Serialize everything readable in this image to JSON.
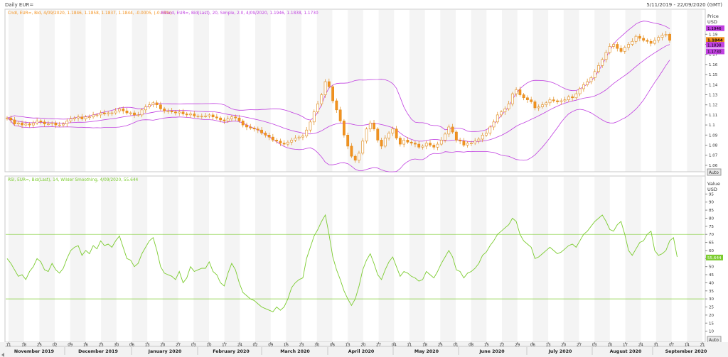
{
  "window": {
    "title": "Daily EUR=",
    "date_range": "5/11/2019 - 22/09/2020 (GMT)"
  },
  "price_panel": {
    "legend_ohlc": "Cndl, EUR=, Bid, 4/09/2020, 1.1846, 1.1858, 1.1837, 1.1844, -0.0005, (-0.04%)",
    "legend_bband": "BBand, EUR=, Bid(Last), 20, Simple, 2.0, 4/09/2020, 1.1946, 1.1838, 1.1730",
    "axis_title": "Price",
    "axis_unit": "USD",
    "auto_label": "Auto",
    "ticks": [
      "1.06",
      "1.07",
      "1.08",
      "1.09",
      "1.1",
      "1.11",
      "1.12",
      "1.13",
      "1.14",
      "1.15",
      "1.16",
      "1.17",
      "1.18",
      "1.19"
    ],
    "markers": [
      {
        "value": "1.1946",
        "y": 1.1946,
        "color": "#c040e0"
      },
      {
        "value": "1.1844",
        "y": 1.1844,
        "color": "#f39220"
      },
      {
        "value": "1.1838",
        "y": 1.1838,
        "color": "#c040e0"
      },
      {
        "value": "1.1730",
        "y": 1.173,
        "color": "#c040e0"
      }
    ]
  },
  "rsi_panel": {
    "legend": "RSI, EUR=, Bid(Last), 14, Wilder Smoothing, 4/09/2020, 55.644",
    "axis_title": "Value",
    "axis_unit": "USD",
    "auto_label": "Auto",
    "ticks": [
      "10",
      "15",
      "20",
      "25",
      "30",
      "35",
      "40",
      "45",
      "50",
      "55",
      "60",
      "65",
      "70",
      "75",
      "80",
      "85",
      "90",
      "95"
    ],
    "marker": {
      "value": "55.644",
      "y": 55.644,
      "color": "#7ccc30"
    }
  },
  "x_axis": {
    "day_ticks": [
      "11",
      "18",
      "25",
      "02",
      "09",
      "16",
      "23",
      "30",
      "06",
      "13",
      "20",
      "27",
      "03",
      "10",
      "17",
      "24",
      "02",
      "09",
      "16",
      "23",
      "30",
      "06",
      "13",
      "20",
      "27",
      "04",
      "11",
      "18",
      "25",
      "01",
      "08",
      "15",
      "22",
      "29",
      "06",
      "13",
      "20",
      "27",
      "03",
      "10",
      "17",
      "24",
      "31",
      "07",
      "14",
      "21"
    ],
    "month_labels": [
      "November 2019",
      "December 2019",
      "January 2020",
      "February 2020",
      "March 2020",
      "April 2020",
      "May 2020",
      "June 2020",
      "July 2020",
      "August 2020",
      "September 2020"
    ]
  },
  "chart_data": [
    {
      "type": "candlestick",
      "title": "Daily EUR=",
      "x_start": "2019-11-05",
      "x_end": "2020-09-04",
      "ylabel": "Price USD",
      "ylim": [
        1.055,
        1.205
      ],
      "close_approx": [
        1.107,
        1.105,
        1.101,
        1.102,
        1.1,
        1.101,
        1.1,
        1.102,
        1.104,
        1.103,
        1.101,
        1.101,
        1.102,
        1.1,
        1.1,
        1.101,
        1.104,
        1.106,
        1.107,
        1.108,
        1.106,
        1.108,
        1.108,
        1.11,
        1.11,
        1.112,
        1.111,
        1.112,
        1.112,
        1.114,
        1.116,
        1.114,
        1.112,
        1.112,
        1.11,
        1.11,
        1.115,
        1.118,
        1.12,
        1.122,
        1.12,
        1.116,
        1.114,
        1.114,
        1.113,
        1.112,
        1.113,
        1.111,
        1.11,
        1.111,
        1.109,
        1.109,
        1.109,
        1.109,
        1.11,
        1.108,
        1.107,
        1.105,
        1.104,
        1.106,
        1.108,
        1.107,
        1.104,
        1.1,
        1.098,
        1.097,
        1.096,
        1.095,
        1.092,
        1.09,
        1.088,
        1.085,
        1.084,
        1.082,
        1.081,
        1.083,
        1.085,
        1.087,
        1.088,
        1.089,
        1.095,
        1.103,
        1.113,
        1.121,
        1.13,
        1.143,
        1.138,
        1.124,
        1.115,
        1.104,
        1.09,
        1.079,
        1.069,
        1.065,
        1.072,
        1.084,
        1.096,
        1.102,
        1.096,
        1.085,
        1.079,
        1.087,
        1.092,
        1.096,
        1.087,
        1.081,
        1.085,
        1.083,
        1.082,
        1.081,
        1.078,
        1.079,
        1.082,
        1.08,
        1.078,
        1.081,
        1.085,
        1.091,
        1.098,
        1.093,
        1.085,
        1.084,
        1.08,
        1.082,
        1.082,
        1.084,
        1.086,
        1.09,
        1.092,
        1.098,
        1.103,
        1.11,
        1.113,
        1.116,
        1.121,
        1.131,
        1.135,
        1.13,
        1.127,
        1.125,
        1.123,
        1.117,
        1.118,
        1.12,
        1.122,
        1.125,
        1.124,
        1.123,
        1.124,
        1.125,
        1.128,
        1.127,
        1.131,
        1.136,
        1.14,
        1.143,
        1.147,
        1.153,
        1.159,
        1.165,
        1.172,
        1.178,
        1.18,
        1.176,
        1.173,
        1.177,
        1.18,
        1.183,
        1.188,
        1.186,
        1.184,
        1.183,
        1.181,
        1.184,
        1.187,
        1.189,
        1.19,
        1.184
      ]
    },
    {
      "type": "line",
      "ylabel": "RSI",
      "ylim": [
        5,
        100
      ],
      "reference_lines": [
        70,
        30
      ],
      "x_start": "2019-11-05",
      "x_end": "2020-09-04",
      "series": [
        {
          "name": "RSI 14",
          "color": "#7ccc30",
          "values": [
            55,
            52,
            48,
            44,
            45,
            42,
            47,
            50,
            55,
            53,
            48,
            47,
            52,
            48,
            46,
            49,
            55,
            60,
            62,
            63,
            57,
            60,
            58,
            63,
            61,
            66,
            63,
            64,
            62,
            66,
            69,
            62,
            55,
            54,
            50,
            52,
            58,
            62,
            66,
            68,
            60,
            50,
            46,
            45,
            44,
            42,
            47,
            40,
            43,
            50,
            47,
            48,
            49,
            49,
            53,
            47,
            45,
            40,
            38,
            46,
            52,
            48,
            40,
            34,
            32,
            30,
            29,
            27,
            25,
            24,
            23,
            22,
            25,
            23,
            25,
            30,
            37,
            40,
            42,
            43,
            55,
            62,
            69,
            73,
            78,
            82,
            70,
            56,
            48,
            42,
            35,
            30,
            26,
            30,
            38,
            48,
            54,
            58,
            52,
            45,
            42,
            48,
            53,
            56,
            50,
            44,
            47,
            46,
            44,
            43,
            41,
            42,
            47,
            45,
            43,
            47,
            52,
            56,
            60,
            56,
            48,
            47,
            43,
            46,
            47,
            49,
            52,
            57,
            59,
            63,
            66,
            70,
            72,
            74,
            76,
            80,
            78,
            70,
            66,
            64,
            62,
            55,
            56,
            58,
            60,
            62,
            60,
            58,
            59,
            61,
            63,
            64,
            62,
            66,
            70,
            72,
            75,
            78,
            80,
            82,
            78,
            73,
            72,
            76,
            78,
            70,
            60,
            57,
            61,
            65,
            66,
            70,
            72,
            60,
            57,
            58,
            60,
            66,
            68,
            56
          ]
        }
      ]
    }
  ]
}
